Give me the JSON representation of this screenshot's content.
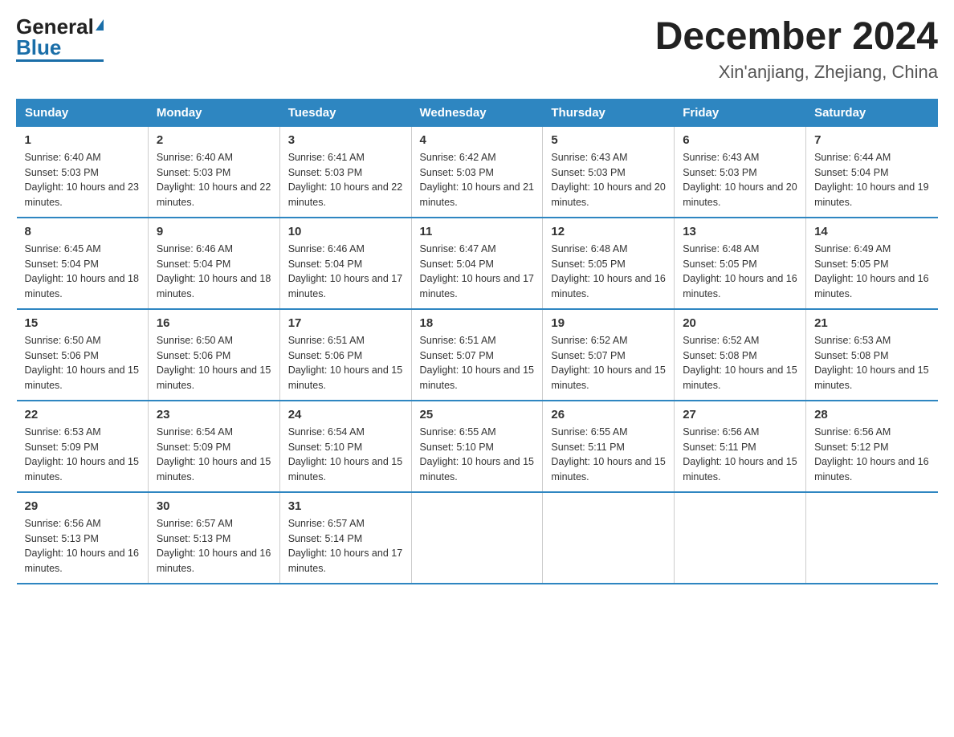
{
  "header": {
    "logo_general": "General",
    "logo_blue": "Blue",
    "main_title": "December 2024",
    "subtitle": "Xin'anjiang, Zhejiang, China"
  },
  "days_of_week": [
    "Sunday",
    "Monday",
    "Tuesday",
    "Wednesday",
    "Thursday",
    "Friday",
    "Saturday"
  ],
  "weeks": [
    [
      {
        "day": "1",
        "sunrise": "6:40 AM",
        "sunset": "5:03 PM",
        "daylight": "10 hours and 23 minutes."
      },
      {
        "day": "2",
        "sunrise": "6:40 AM",
        "sunset": "5:03 PM",
        "daylight": "10 hours and 22 minutes."
      },
      {
        "day": "3",
        "sunrise": "6:41 AM",
        "sunset": "5:03 PM",
        "daylight": "10 hours and 22 minutes."
      },
      {
        "day": "4",
        "sunrise": "6:42 AM",
        "sunset": "5:03 PM",
        "daylight": "10 hours and 21 minutes."
      },
      {
        "day": "5",
        "sunrise": "6:43 AM",
        "sunset": "5:03 PM",
        "daylight": "10 hours and 20 minutes."
      },
      {
        "day": "6",
        "sunrise": "6:43 AM",
        "sunset": "5:03 PM",
        "daylight": "10 hours and 20 minutes."
      },
      {
        "day": "7",
        "sunrise": "6:44 AM",
        "sunset": "5:04 PM",
        "daylight": "10 hours and 19 minutes."
      }
    ],
    [
      {
        "day": "8",
        "sunrise": "6:45 AM",
        "sunset": "5:04 PM",
        "daylight": "10 hours and 18 minutes."
      },
      {
        "day": "9",
        "sunrise": "6:46 AM",
        "sunset": "5:04 PM",
        "daylight": "10 hours and 18 minutes."
      },
      {
        "day": "10",
        "sunrise": "6:46 AM",
        "sunset": "5:04 PM",
        "daylight": "10 hours and 17 minutes."
      },
      {
        "day": "11",
        "sunrise": "6:47 AM",
        "sunset": "5:04 PM",
        "daylight": "10 hours and 17 minutes."
      },
      {
        "day": "12",
        "sunrise": "6:48 AM",
        "sunset": "5:05 PM",
        "daylight": "10 hours and 16 minutes."
      },
      {
        "day": "13",
        "sunrise": "6:48 AM",
        "sunset": "5:05 PM",
        "daylight": "10 hours and 16 minutes."
      },
      {
        "day": "14",
        "sunrise": "6:49 AM",
        "sunset": "5:05 PM",
        "daylight": "10 hours and 16 minutes."
      }
    ],
    [
      {
        "day": "15",
        "sunrise": "6:50 AM",
        "sunset": "5:06 PM",
        "daylight": "10 hours and 15 minutes."
      },
      {
        "day": "16",
        "sunrise": "6:50 AM",
        "sunset": "5:06 PM",
        "daylight": "10 hours and 15 minutes."
      },
      {
        "day": "17",
        "sunrise": "6:51 AM",
        "sunset": "5:06 PM",
        "daylight": "10 hours and 15 minutes."
      },
      {
        "day": "18",
        "sunrise": "6:51 AM",
        "sunset": "5:07 PM",
        "daylight": "10 hours and 15 minutes."
      },
      {
        "day": "19",
        "sunrise": "6:52 AM",
        "sunset": "5:07 PM",
        "daylight": "10 hours and 15 minutes."
      },
      {
        "day": "20",
        "sunrise": "6:52 AM",
        "sunset": "5:08 PM",
        "daylight": "10 hours and 15 minutes."
      },
      {
        "day": "21",
        "sunrise": "6:53 AM",
        "sunset": "5:08 PM",
        "daylight": "10 hours and 15 minutes."
      }
    ],
    [
      {
        "day": "22",
        "sunrise": "6:53 AM",
        "sunset": "5:09 PM",
        "daylight": "10 hours and 15 minutes."
      },
      {
        "day": "23",
        "sunrise": "6:54 AM",
        "sunset": "5:09 PM",
        "daylight": "10 hours and 15 minutes."
      },
      {
        "day": "24",
        "sunrise": "6:54 AM",
        "sunset": "5:10 PM",
        "daylight": "10 hours and 15 minutes."
      },
      {
        "day": "25",
        "sunrise": "6:55 AM",
        "sunset": "5:10 PM",
        "daylight": "10 hours and 15 minutes."
      },
      {
        "day": "26",
        "sunrise": "6:55 AM",
        "sunset": "5:11 PM",
        "daylight": "10 hours and 15 minutes."
      },
      {
        "day": "27",
        "sunrise": "6:56 AM",
        "sunset": "5:11 PM",
        "daylight": "10 hours and 15 minutes."
      },
      {
        "day": "28",
        "sunrise": "6:56 AM",
        "sunset": "5:12 PM",
        "daylight": "10 hours and 16 minutes."
      }
    ],
    [
      {
        "day": "29",
        "sunrise": "6:56 AM",
        "sunset": "5:13 PM",
        "daylight": "10 hours and 16 minutes."
      },
      {
        "day": "30",
        "sunrise": "6:57 AM",
        "sunset": "5:13 PM",
        "daylight": "10 hours and 16 minutes."
      },
      {
        "day": "31",
        "sunrise": "6:57 AM",
        "sunset": "5:14 PM",
        "daylight": "10 hours and 17 minutes."
      },
      {
        "day": "",
        "sunrise": "",
        "sunset": "",
        "daylight": ""
      },
      {
        "day": "",
        "sunrise": "",
        "sunset": "",
        "daylight": ""
      },
      {
        "day": "",
        "sunrise": "",
        "sunset": "",
        "daylight": ""
      },
      {
        "day": "",
        "sunrise": "",
        "sunset": "",
        "daylight": ""
      }
    ]
  ]
}
